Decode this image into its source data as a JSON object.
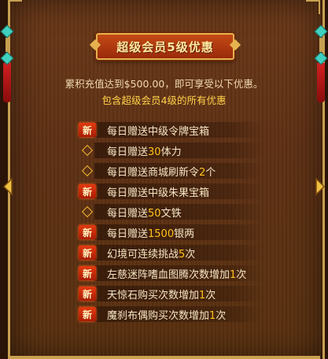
{
  "title": "超级会员5级优惠",
  "description": "累积充值达到$500.00，即可享受以下优惠。",
  "inherit_note": "包含超级会员4级的所有优惠",
  "new_badge": "新",
  "benefits": [
    {
      "badge": "new",
      "pre": "每日赠送中级令牌宝箱",
      "hl": "",
      "post": ""
    },
    {
      "badge": "diamond",
      "pre": "每日赠送",
      "hl": "30",
      "post": "体力"
    },
    {
      "badge": "diamond",
      "pre": "每日赠送商城刷新令",
      "hl": "2",
      "post": "个"
    },
    {
      "badge": "new",
      "pre": "每日赠送中级朱果宝箱",
      "hl": "",
      "post": ""
    },
    {
      "badge": "diamond",
      "pre": "每日赠送",
      "hl": "50",
      "post": "文铁"
    },
    {
      "badge": "new",
      "pre": "每日赠送",
      "hl": "1500",
      "post": "银两"
    },
    {
      "badge": "new",
      "pre": "幻境可连续挑战",
      "hl": "5",
      "post": "次"
    },
    {
      "badge": "new",
      "pre": "左慈迷阵嗜血图腾次数增加",
      "hl": "1",
      "post": "次"
    },
    {
      "badge": "new",
      "pre": "天惊石购买次数增加",
      "hl": "1",
      "post": "次"
    },
    {
      "badge": "new",
      "pre": "魔刹布偶购买次数增加",
      "hl": "1",
      "post": "次"
    }
  ],
  "colors": {
    "accent": "#ffc21a",
    "text": "#f6e6c4",
    "badge": "#d02a0a",
    "frame": "#c8a050"
  },
  "icons": {
    "nav_left": "arrow-left-icon",
    "nav_right": "arrow-right-icon",
    "diamond": "diamond-icon"
  }
}
